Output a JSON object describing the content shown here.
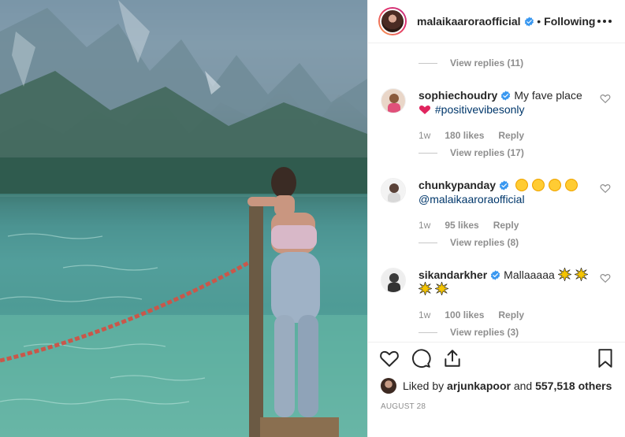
{
  "post": {
    "author": "malaikaaroraofficial",
    "follow_separator": "•",
    "follow_status": "Following",
    "date": "AUGUST 28"
  },
  "comments_pane": {
    "top_view_replies": "View replies (11)",
    "comments": [
      {
        "username": "sophiechoudry",
        "text": "My fave place",
        "hashtag": "#positivevibesonly",
        "age": "1w",
        "likes": "180 likes",
        "reply_label": "Reply",
        "view_replies": "View replies (17)"
      },
      {
        "username": "chunkypanday",
        "mention": "@malaikaaroraofficial",
        "age": "1w",
        "likes": "95 likes",
        "reply_label": "Reply",
        "view_replies": "View replies (8)"
      },
      {
        "username": "sikandarkher",
        "text": "Mallaaaaa",
        "age": "1w",
        "likes": "100 likes",
        "reply_label": "Reply",
        "view_replies": "View replies (3)"
      }
    ]
  },
  "likes_bar": {
    "prefix": "Liked by",
    "liker": "arjunkapoor",
    "conjunction": "and",
    "others": "557,518 others"
  },
  "icons": {
    "heart": "heart-icon",
    "comment": "comment-icon",
    "share": "share-icon",
    "bookmark": "bookmark-icon",
    "verified": "verified-badge-icon",
    "more": "more-options-icon"
  },
  "colors": {
    "verified_blue": "#3897f0",
    "link_blue": "#00376b",
    "muted_grey": "#8e8e8e",
    "heart_red": "#e0245e"
  }
}
